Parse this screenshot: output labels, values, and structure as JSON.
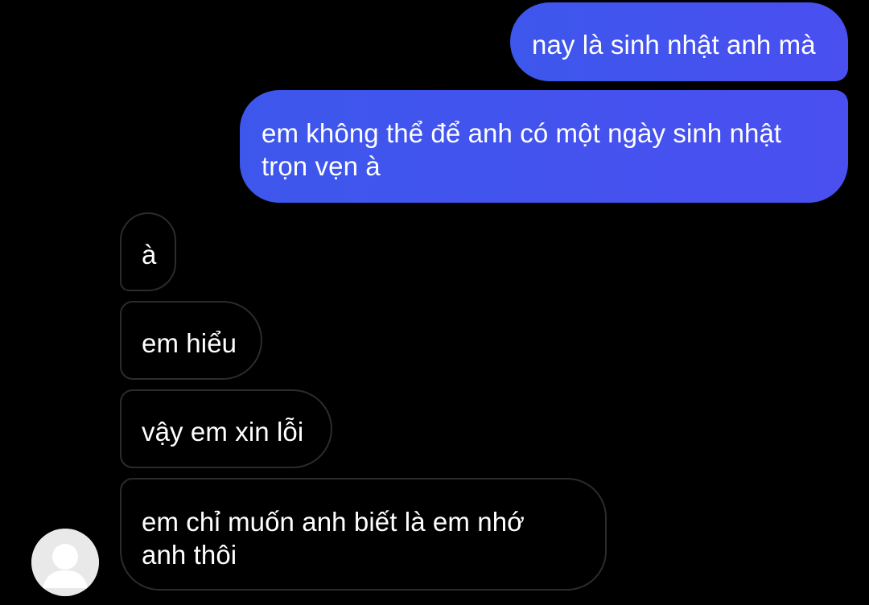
{
  "conversation": {
    "sent_messages": [
      {
        "lines": [
          "nay là sinh nhật anh mà"
        ]
      },
      {
        "lines": [
          "em không thể để anh có một ngày sinh nhật",
          "trọn vẹn à"
        ]
      }
    ],
    "received_messages": [
      {
        "lines": [
          "à"
        ]
      },
      {
        "lines": [
          "em hiểu"
        ]
      },
      {
        "lines": [
          "vậy em xin lỗi"
        ]
      },
      {
        "lines": [
          "em chỉ muốn anh biết là em nhớ",
          "anh thôi"
        ]
      }
    ],
    "contact_avatar_icon": "default-user-avatar-icon"
  },
  "colors": {
    "background": "#000000",
    "sent_bubble": "#4353ee",
    "received_bubble_border": "#2c2c2c",
    "text": "#ffffff",
    "avatar_bg": "#e9e9e9",
    "avatar_silhouette": "#ffffff"
  }
}
